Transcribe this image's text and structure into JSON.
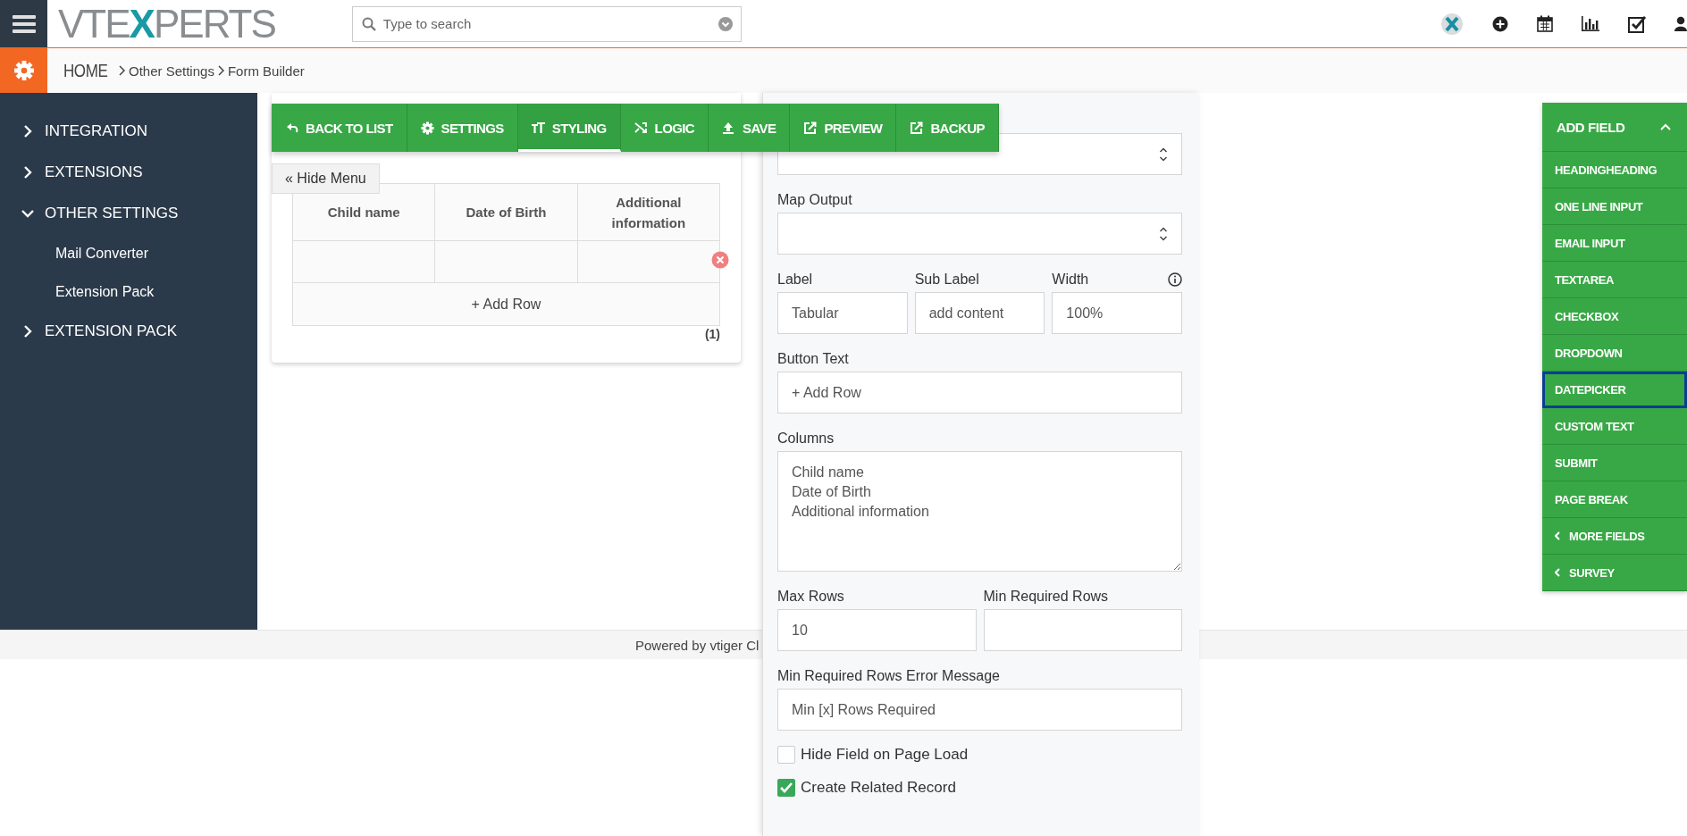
{
  "header": {
    "logo": "VTEXPERTS",
    "search": {
      "placeholder": "Type to search"
    }
  },
  "breadcrumb": [
    {
      "label": "HOME"
    },
    {
      "label": "Other Settings"
    },
    {
      "label": "Form Builder"
    }
  ],
  "sidebar": {
    "items": [
      {
        "label": "INTEGRATION",
        "expanded": false
      },
      {
        "label": "EXTENSIONS",
        "expanded": false
      },
      {
        "label": "OTHER SETTINGS",
        "expanded": true,
        "children": [
          {
            "label": "Mail Converter"
          },
          {
            "label": "Extension Pack"
          }
        ]
      },
      {
        "label": "EXTENSION PACK",
        "expanded": false
      }
    ]
  },
  "toolbar": [
    {
      "label": "BACK TO LIST",
      "kind": "back",
      "selected": false
    },
    {
      "label": "SETTINGS",
      "kind": "settings",
      "selected": false
    },
    {
      "label": "STYLING",
      "kind": "styling",
      "selected": true
    },
    {
      "label": "LOGIC",
      "kind": "logic",
      "selected": false
    },
    {
      "label": "SAVE",
      "kind": "save",
      "selected": false
    },
    {
      "label": "PREVIEW",
      "kind": "preview",
      "selected": false
    },
    {
      "label": "BACKUP",
      "kind": "backup",
      "selected": false
    }
  ],
  "hide_menu": "« Hide Menu",
  "table": {
    "columns": [
      "Child name",
      "Date of Birth",
      "Additional information"
    ],
    "rows": [
      {
        "removable": true
      }
    ],
    "add_row": "+ Add Row",
    "count": "(1)"
  },
  "panel": {
    "rows": [
      [
        {
          "kind": "select"
        }
      ],
      [
        {
          "kind": "select",
          "label": "Map Output"
        }
      ],
      [
        {
          "kind": "text",
          "label": "Label",
          "value": "Tabular"
        },
        {
          "kind": "text",
          "label": "Sub Label",
          "value": "add content"
        },
        {
          "kind": "text",
          "label": "Width",
          "value": "100%",
          "info": true
        }
      ],
      [
        {
          "kind": "text",
          "label": "Button Text",
          "value": "+ Add Row"
        }
      ],
      [
        {
          "kind": "textarea",
          "label": "Columns",
          "value": "Child name\nDate of Birth\nAdditional information"
        }
      ],
      [
        {
          "kind": "text",
          "label": "Max Rows",
          "value": "10"
        },
        {
          "kind": "text",
          "label": "Min Required Rows"
        }
      ],
      [
        {
          "kind": "text",
          "label": "Min Required Rows Error Message",
          "value": "Min [x] Rows Required"
        }
      ],
      [
        {
          "kind": "checkbox",
          "label": "Hide Field on Page Load",
          "checked": false
        }
      ],
      [
        {
          "kind": "checkbox",
          "label": "Create Related Record",
          "checked": true
        }
      ]
    ]
  },
  "add_field": {
    "title": "ADD FIELD",
    "expanded": true,
    "items": [
      {
        "label": "HEADINGHEADING",
        "kind": "field",
        "selected": false
      },
      {
        "label": "ONE LINE INPUT",
        "kind": "field",
        "selected": false
      },
      {
        "label": "EMAIL INPUT",
        "kind": "field",
        "selected": false
      },
      {
        "label": "TEXTAREA",
        "kind": "field",
        "selected": false
      },
      {
        "label": "CHECKBOX",
        "kind": "field",
        "selected": false
      },
      {
        "label": "DROPDOWN",
        "kind": "field",
        "selected": false
      },
      {
        "label": "DATEPICKER",
        "kind": "field",
        "selected": true
      },
      {
        "label": "CUSTOM TEXT",
        "kind": "field",
        "selected": false
      },
      {
        "label": "SUBMIT",
        "kind": "field",
        "selected": false
      },
      {
        "label": "PAGE BREAK",
        "kind": "field",
        "selected": false
      },
      {
        "label": "MORE FIELDS",
        "kind": "group",
        "selected": false
      },
      {
        "label": "SURVEY",
        "kind": "group",
        "selected": false
      }
    ]
  },
  "footer": "Powered by vtiger Cl"
}
